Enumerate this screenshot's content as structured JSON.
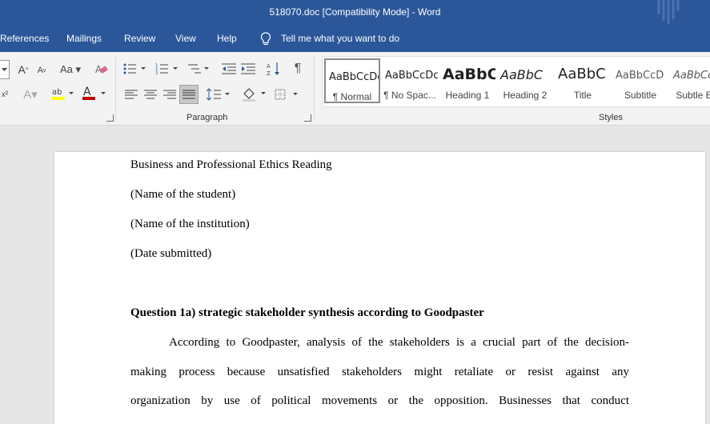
{
  "window": {
    "title": "518070.doc [Compatibility Mode]  -  Word"
  },
  "tabs": [
    "References",
    "Mailings",
    "Review",
    "View",
    "Help"
  ],
  "tell_me": {
    "label": "Tell me what you want to do"
  },
  "ribbon": {
    "paragraph_label": "Paragraph",
    "styles_label": "Styles",
    "styles": [
      {
        "preview": "AaBbCcDc",
        "name": "¶ Normal"
      },
      {
        "preview": "AaBbCcDc",
        "name": "¶ No Spac..."
      },
      {
        "preview": "AaBbC",
        "name": "Heading 1"
      },
      {
        "preview": "AaBbC",
        "name": "Heading 2"
      },
      {
        "preview": "AaBbC",
        "name": "Title"
      },
      {
        "preview": "AaBbCcD",
        "name": "Subtitle"
      },
      {
        "preview": "AaBbCc",
        "name": "Subtle Em"
      }
    ]
  },
  "document": {
    "lines": [
      "Business and Professional Ethics Reading",
      "(Name of the student)",
      "(Name of the institution)",
      "(Date submitted)"
    ],
    "heading": "Question 1a) strategic stakeholder synthesis according to Goodpaster",
    "body": [
      "According to Goodpaster, analysis of the stakeholders is a crucial part of the decision-",
      "making process because unsatisfied stakeholders might retaliate or resist against any",
      "organization by use of political movements or the opposition. Businesses that conduct"
    ]
  },
  "colors": {
    "accent": "#2b579a",
    "font_color_bar": "#c00000",
    "highlight_bar": "#ffff00"
  }
}
